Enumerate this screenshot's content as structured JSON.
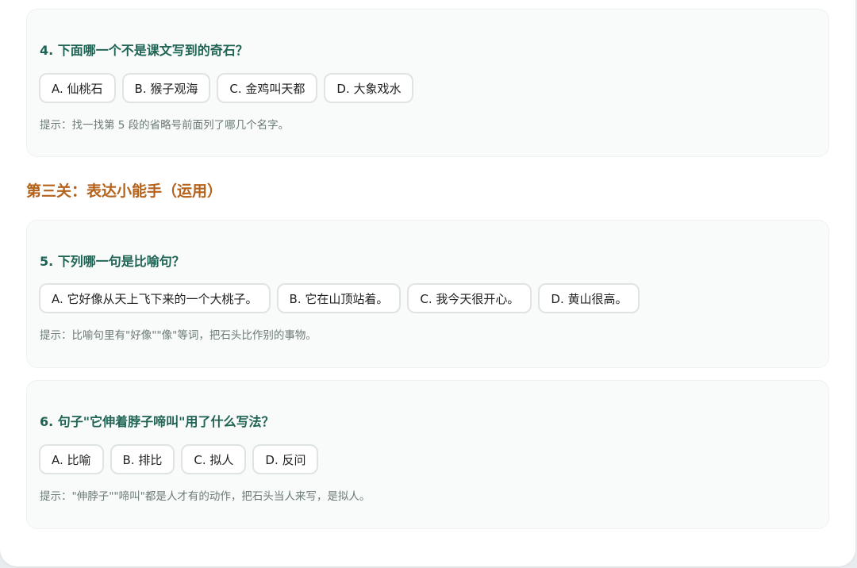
{
  "questions": [
    {
      "title": "4. 下面哪一个不是课文写到的奇石？",
      "options": [
        "A. 仙桃石",
        "B. 猴子观海",
        "C. 金鸡叫天都",
        "D. 大象戏水"
      ],
      "hint": "提示：找一找第 5 段的省略号前面列了哪几个名字。"
    },
    {
      "title": "5. 下列哪一句是比喻句？",
      "options": [
        "A. 它好像从天上飞下来的一个大桃子。",
        "B. 它在山顶站着。",
        "C. 我今天很开心。",
        "D. 黄山很高。"
      ],
      "hint": "提示：比喻句里有\"好像\"\"像\"等词，把石头比作别的事物。"
    },
    {
      "title": "6. 句子\"它伸着脖子啼叫\"用了什么写法？",
      "options": [
        "A. 比喻",
        "B. 排比",
        "C. 拟人",
        "D. 反问"
      ],
      "hint": "提示：\"伸脖子\"\"啼叫\"都是人才有的动作，把石头当人来写，是拟人。"
    }
  ],
  "section": {
    "title": "第三关：表达小能手（运用）"
  },
  "colors": {
    "question_title": "#1e6354",
    "section_title": "#b4621c",
    "hint": "#6c7a77",
    "card_bg": "#f8fbfa"
  }
}
